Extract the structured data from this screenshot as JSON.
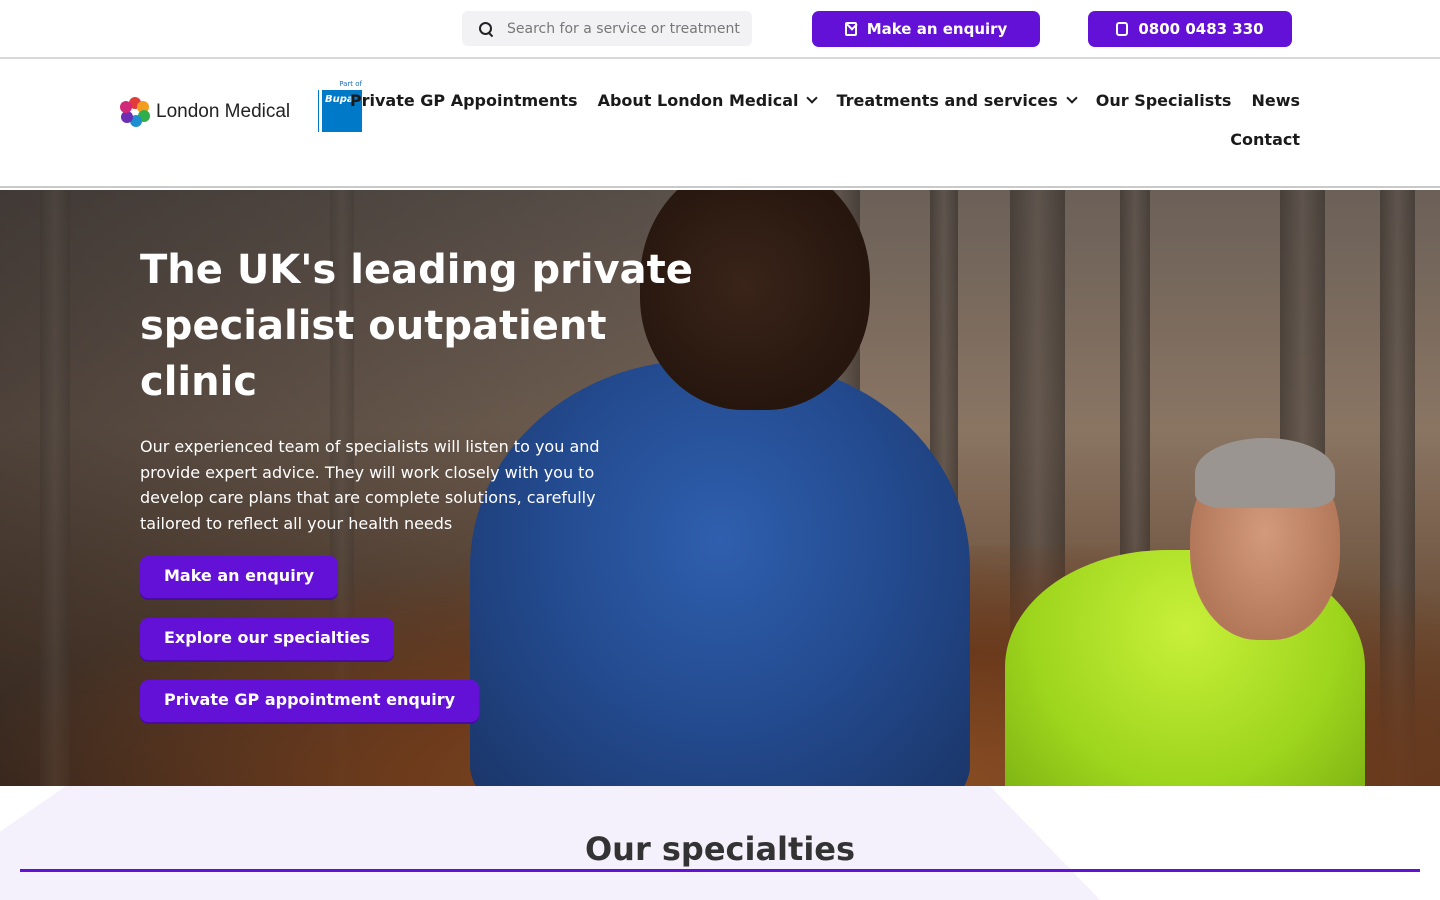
{
  "topbar": {
    "search_placeholder": "Search for a service or treatment",
    "enquiry_label": "Make an enquiry",
    "phone_label": "0800 0483 330"
  },
  "brand": {
    "logo_text": "London Medical",
    "partner_caption": "Part of",
    "partner_name": "Bupa",
    "primary_color": "#6311d6"
  },
  "nav": {
    "items": [
      {
        "label": "Private GP Appointments",
        "has_dropdown": false
      },
      {
        "label": "About London Medical",
        "has_dropdown": true
      },
      {
        "label": "Treatments and services",
        "has_dropdown": true
      },
      {
        "label": "Our Specialists",
        "has_dropdown": false
      },
      {
        "label": "News",
        "has_dropdown": false
      },
      {
        "label": "Contact",
        "has_dropdown": false
      }
    ]
  },
  "hero": {
    "title": "The UK's leading private specialist outpatient clinic",
    "description": "Our experienced team of specialists will listen to you and provide expert advice. They will work closely with you to develop care plans that are complete solutions, carefully tailored to reflect all your health needs",
    "buttons": [
      {
        "label": "Make an enquiry"
      },
      {
        "label": "Explore our specialties"
      },
      {
        "label": "Private GP appointment enquiry"
      }
    ]
  },
  "specialties": {
    "heading": "Our specialties"
  }
}
